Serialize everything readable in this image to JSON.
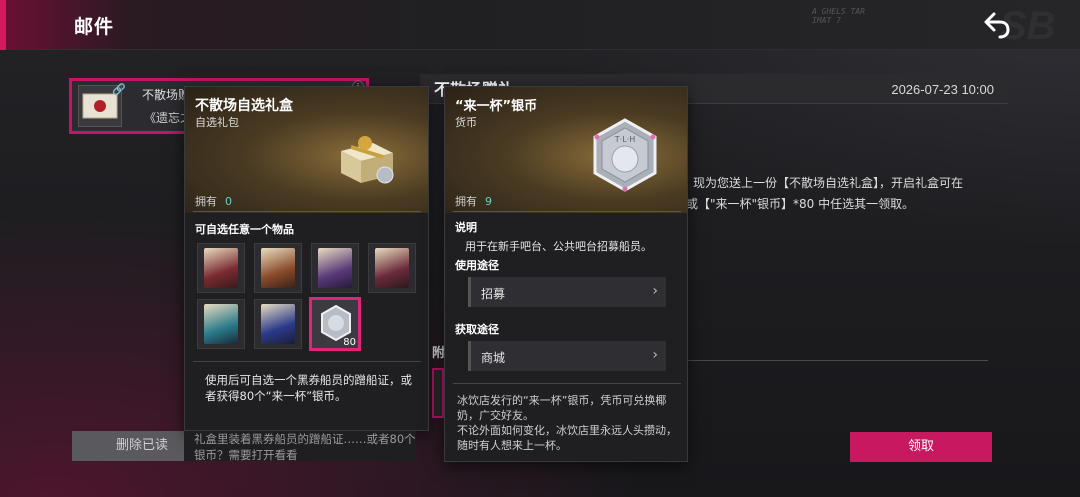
{
  "header": {
    "title": "邮件",
    "deco_text": "A GHELS TAR\nIMAT 7",
    "deco_big": "SB",
    "back_label": "back"
  },
  "mail_list": {
    "items": [
      {
        "title": "不散场赠",
        "subtitle": "《遗忘之",
        "selected": true
      }
    ],
    "delete_read_label": "删除已读"
  },
  "mail_detail": {
    "title_peek": "不散场赠礼",
    "date": "2026-07-23 10:00",
    "body_line1": "现为您送上一份【不散场自选礼盒】，开启礼盒可在",
    "body_line2": "或【\"来一杯\"银币】*80 中任选其一领取。",
    "attachments_peek": "附件",
    "claim_label": "领取"
  },
  "popup_gift": {
    "name": "不散场自选礼盒",
    "type": "自选礼包",
    "own_label": "拥有",
    "own_count": "0",
    "section_label": "可自选任意一个物品",
    "options": [
      {
        "kind": "card",
        "color": "#7a2a30"
      },
      {
        "kind": "card",
        "color": "#8a4a2a"
      },
      {
        "kind": "card",
        "color": "#5a3a7a"
      },
      {
        "kind": "card",
        "color": "#6a2a3a"
      },
      {
        "kind": "card",
        "color": "#2a7a8a"
      },
      {
        "kind": "card",
        "color": "#2a3a8a"
      },
      {
        "kind": "coin",
        "badge": "80",
        "selected": true
      }
    ],
    "description": "使用后可自选一个黑券船员的蹭船证，或者获得80个“来一杯”银币。",
    "description2": "礼盒里装着黑券船员的蹭船证……或者80个银币？需要打开看看"
  },
  "popup_coin": {
    "name": "“来一杯”银币",
    "type": "货币",
    "own_label": "拥有",
    "own_count": "9",
    "coin_label": "T·L·H",
    "desc_heading": "说明",
    "desc_text": "用于在新手吧台、公共吧台招募船员。",
    "usage_heading": "使用途径",
    "usage_item": "招募",
    "source_heading": "获取途径",
    "source_item": "商城",
    "flavor": "冰饮店发行的“来一杯”银币，凭币可兑换椰奶，广交好友。\n不论外面如何变化，冰饮店里永远人头攒动，随时有人想来上一杯。"
  },
  "colors": {
    "accent": "#c8185f",
    "accent_light": "#e0247a",
    "count_teal": "#6ad0c0"
  }
}
